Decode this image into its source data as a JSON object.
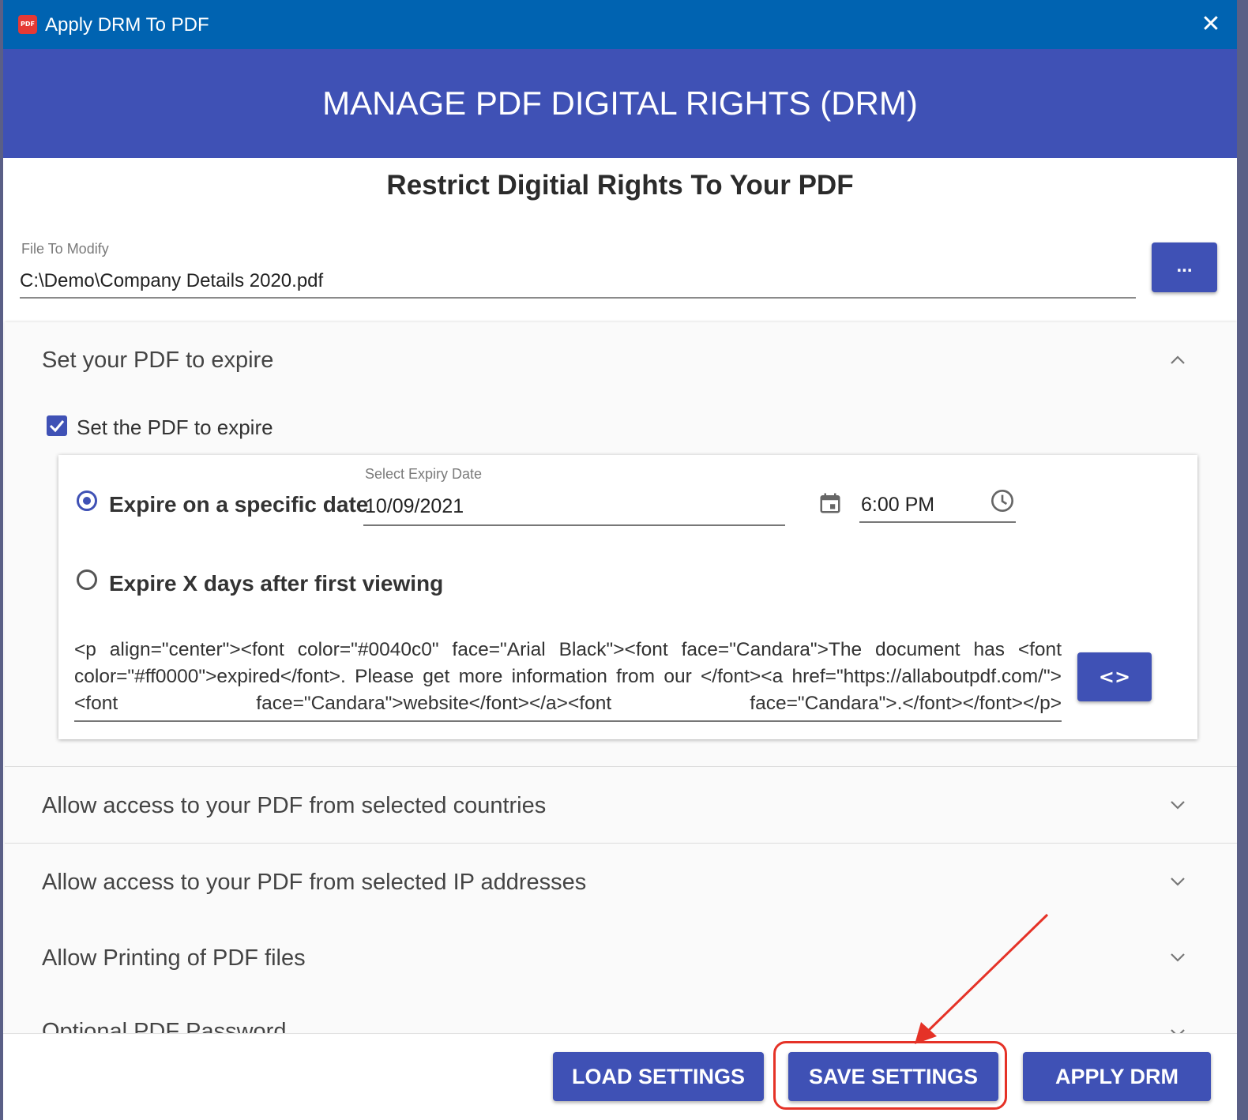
{
  "window": {
    "title": "Apply DRM To PDF",
    "app_icon_text": "PDF",
    "close_glyph": "✕"
  },
  "header": {
    "banner": "MANAGE PDF DIGITAL RIGHTS (DRM)",
    "subtitle": "Restrict Digitial Rights To Your PDF"
  },
  "file": {
    "label": "File To Modify",
    "value": "C:\\Demo\\Company Details 2020.pdf",
    "browse_label": "..."
  },
  "expire_panel": {
    "title": "Set your PDF to expire",
    "expanded": true,
    "checkbox_label": "Set the PDF to expire",
    "checkbox_checked": true,
    "option_specific_date": "Expire on a specific date",
    "option_days_after": "Expire X days after first viewing",
    "selected_option": "specific_date",
    "date_caption": "Select Expiry Date",
    "date_value": "10/09/2021",
    "time_value": "6:00 PM",
    "expired_message_html": "<p align=\"center\"><font color=\"#0040c0\" face=\"Arial Black\"><font face=\"Candara\">The document has <font color=\"#ff0000\">expired</font>. Please get more information from our </font><a href=\"https://allaboutpdf.com/\"><font face=\"Candara\">website</font></a><font face=\"Candara\">.</font></font></p>",
    "code_button_label": "<>"
  },
  "panels": [
    {
      "title": "Allow access to your PDF from selected countries",
      "expanded": false
    },
    {
      "title": "Allow access to your PDF from selected IP addresses",
      "expanded": false
    },
    {
      "title": "Allow Printing of PDF files",
      "expanded": false
    },
    {
      "title": "Optional PDF Password",
      "expanded": false
    }
  ],
  "footer": {
    "load_label": "LOAD SETTINGS",
    "save_label": "SAVE SETTINGS",
    "apply_label": "APPLY DRM"
  },
  "colors": {
    "titlebar": "#0063b1",
    "primary": "#3f51b5",
    "annotation": "#e53227"
  },
  "icons": {
    "app": "pdf-app-icon",
    "close": "close-icon",
    "calendar": "calendar-icon",
    "clock": "clock-icon",
    "chevron_up": "chevron-up-icon",
    "chevron_down": "chevron-down-icon"
  }
}
